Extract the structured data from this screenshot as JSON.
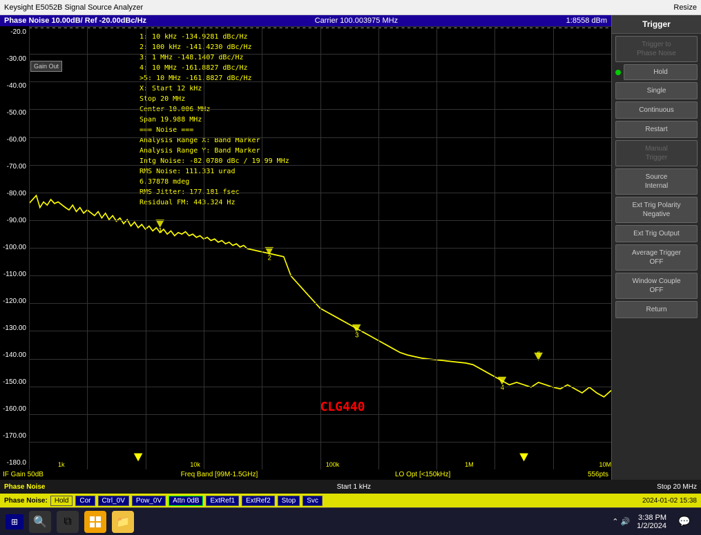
{
  "titlebar": {
    "title": "Keysight E5052B Signal Source Analyzer",
    "resize_label": "Resize"
  },
  "chart": {
    "header_title": "Phase Noise 10.00dB/ Ref -20.00dBc/Hz",
    "carrier": "Carrier 100.003975 MHz",
    "power": "1:8558 dBm",
    "y_labels": [
      "-20.0",
      "-30.00",
      "-40.00",
      "-50.00",
      "-60.00",
      "-70.00",
      "-80.00",
      "-90.00",
      "-100.00",
      "-110.00",
      "-120.00",
      "-130.00",
      "-140.00",
      "-150.00",
      "-160.00",
      "-170.00",
      "-180.0"
    ],
    "freq_labels": [
      "1k",
      "10k",
      "100k",
      "1M",
      "10M"
    ],
    "annotations": [
      "1:  10 kHz    -134.9281 dBc/Hz",
      "2: 100 kHz   -141.4230 dBc/Hz",
      "3:   1 MHz    -148.1407 dBc/Hz",
      "4:  10 MHz   -161.8827 dBc/Hz",
      ">5:  10 MHz   -161.8827 dBc/Hz",
      "X: Start 12 kHz",
      "   Stop 20 MHz",
      "   Center 10.006 MHz",
      "   Span 19.988 MHz",
      "=== Noise ===",
      "Analysis Range X: Band Marker",
      "Analysis Range Y: Band Marker",
      "Intg Noise: -82.0780 dBc / 19.99 MHz",
      "RMS Noise: 111.331 urad",
      "           6.37878 mdeg",
      "RMS Jitter: 177.181 fsec",
      "Residual FM: 443.324 Hz"
    ],
    "clg_label": "CLG440",
    "gain_box": "Gain Out",
    "bottom_if": "IF Gain 50dB",
    "bottom_freq": "Freq Band [99M-1.5GHz]",
    "bottom_lo": "LO Opt [<150kHz]",
    "bottom_pts": "556pts"
  },
  "right_panel": {
    "title": "Trigger",
    "buttons": [
      {
        "id": "trigger-phase-noise",
        "label": "Trigger to\nPhase Noise",
        "disabled": true
      },
      {
        "id": "hold",
        "label": "Hold",
        "has_dot": true,
        "active": true
      },
      {
        "id": "single",
        "label": "Single",
        "disabled": false
      },
      {
        "id": "continuous",
        "label": "Continuous",
        "disabled": false
      },
      {
        "id": "restart",
        "label": "Restart",
        "disabled": false
      },
      {
        "id": "manual-trigger",
        "label": "Manual\nTrigger",
        "disabled": true
      },
      {
        "id": "source-internal",
        "label": "Source\nInternal",
        "disabled": false
      },
      {
        "id": "ext-trig-polarity",
        "label": "Ext Trig Polarity\nNegative",
        "disabled": false
      },
      {
        "id": "ext-trig-output",
        "label": "Ext Trig Output",
        "disabled": false
      },
      {
        "id": "average-trigger",
        "label": "Average Trigger\nOFF",
        "disabled": false
      },
      {
        "id": "window-couple",
        "label": "Window Couple\nOFF",
        "disabled": false
      },
      {
        "id": "return",
        "label": "Return",
        "disabled": false
      }
    ]
  },
  "status_bar_1": {
    "mode": "Phase Noise:",
    "state": "Hold",
    "cor": "Cor",
    "ctrl": "Ctrl_0V",
    "pow": "Pow_0V",
    "attn": "Attn 0dB",
    "extref1": "ExtRef1",
    "extref2": "ExtRef2",
    "stop": "Stop",
    "svc": "Svc",
    "datetime": "2024-01-02 15:38"
  },
  "status_bar_2": {
    "left": "Phase Noise",
    "start": "Start 1 kHz",
    "stop": "Stop 20 MHz"
  },
  "taskbar": {
    "start_label": "⊞",
    "time": "3:38 PM",
    "date": "1/2/2024"
  }
}
